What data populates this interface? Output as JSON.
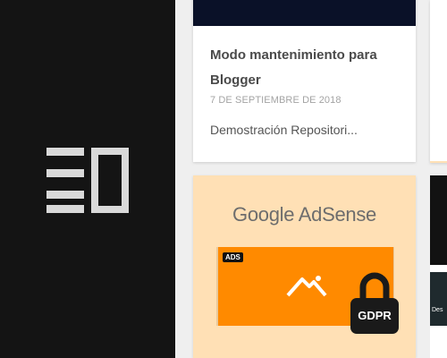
{
  "posts": [
    {
      "title": "Modo mantenimiento para Blogger",
      "date": "7 DE SEPTIEMBRE DE 2018",
      "snippet": "Demostración Repositori..."
    },
    {
      "image": {
        "brand": "Google AdSense",
        "ad_tag": "ADS",
        "lock_label": "GDPR"
      }
    }
  ],
  "peek_post": {
    "text": "Des"
  },
  "colors": {
    "sidebar": "#141414",
    "adsense_bg": "#ffe0b5",
    "ad_orange": "#ff8a00"
  },
  "icons": {
    "logo": "blog-logo-icon",
    "image_placeholder": "mountain-image-icon",
    "lock": "padlock-icon"
  }
}
